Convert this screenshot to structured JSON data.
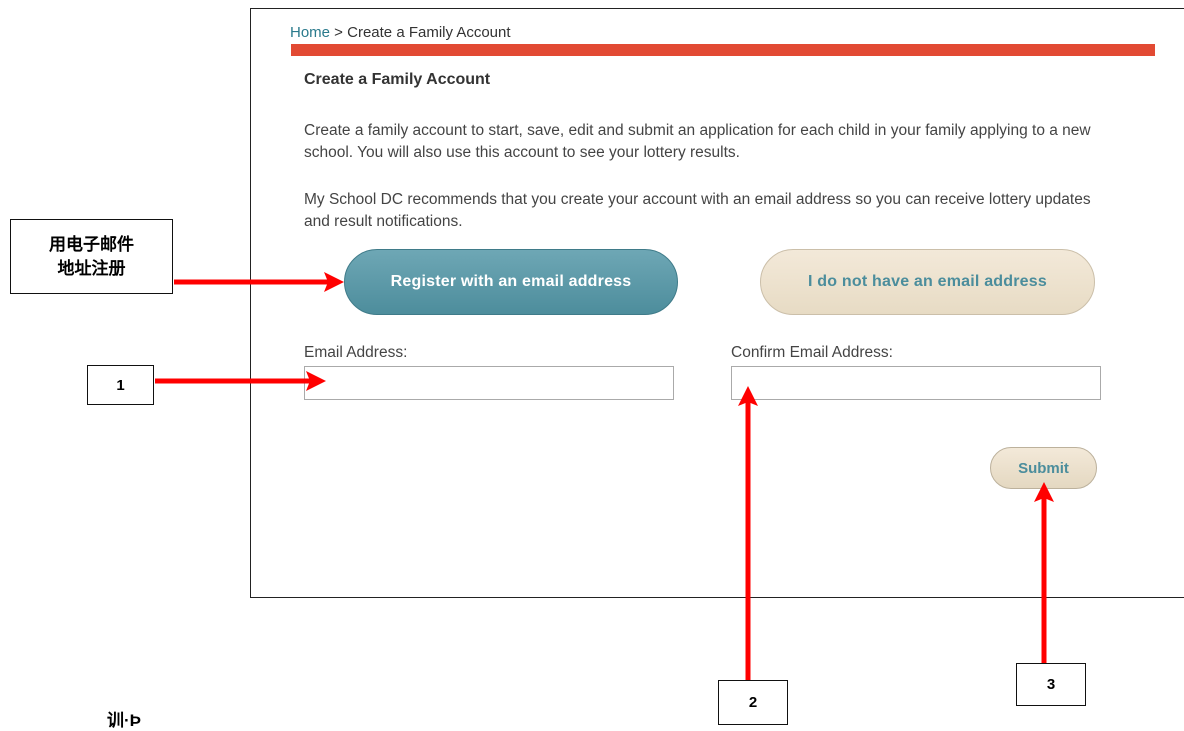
{
  "breadcrumb": {
    "home": "Home",
    "separator": " > ",
    "current": "Create a Family Account"
  },
  "page_title": "Create a Family Account",
  "paragraphs": [
    "Create a family account to start, save, edit and submit an application for each child in your family applying to a new school. You will also use this account to see your lottery results.",
    "My School DC recommends that you create your account with an email address so you can receive lottery updates and result notifications."
  ],
  "buttons": {
    "register": "Register with an email address",
    "no_email": "I do not have an email address",
    "submit": "Submit"
  },
  "form": {
    "email_label": "Email Address:",
    "email_value": "",
    "confirm_label": "Confirm Email Address:",
    "confirm_value": ""
  },
  "callouts": {
    "register_line1": "用电子邮件",
    "register_line2": "地址注册",
    "step1": "1",
    "step2": "2",
    "step3": "3",
    "partial_bottom": "训·Þ"
  },
  "colors": {
    "accent_red": "#e24a33",
    "register_button": "#5a98a7",
    "tan_button": "#efe4d1",
    "link": "#2a7a8c",
    "annotation_arrow": "#ff0000"
  }
}
